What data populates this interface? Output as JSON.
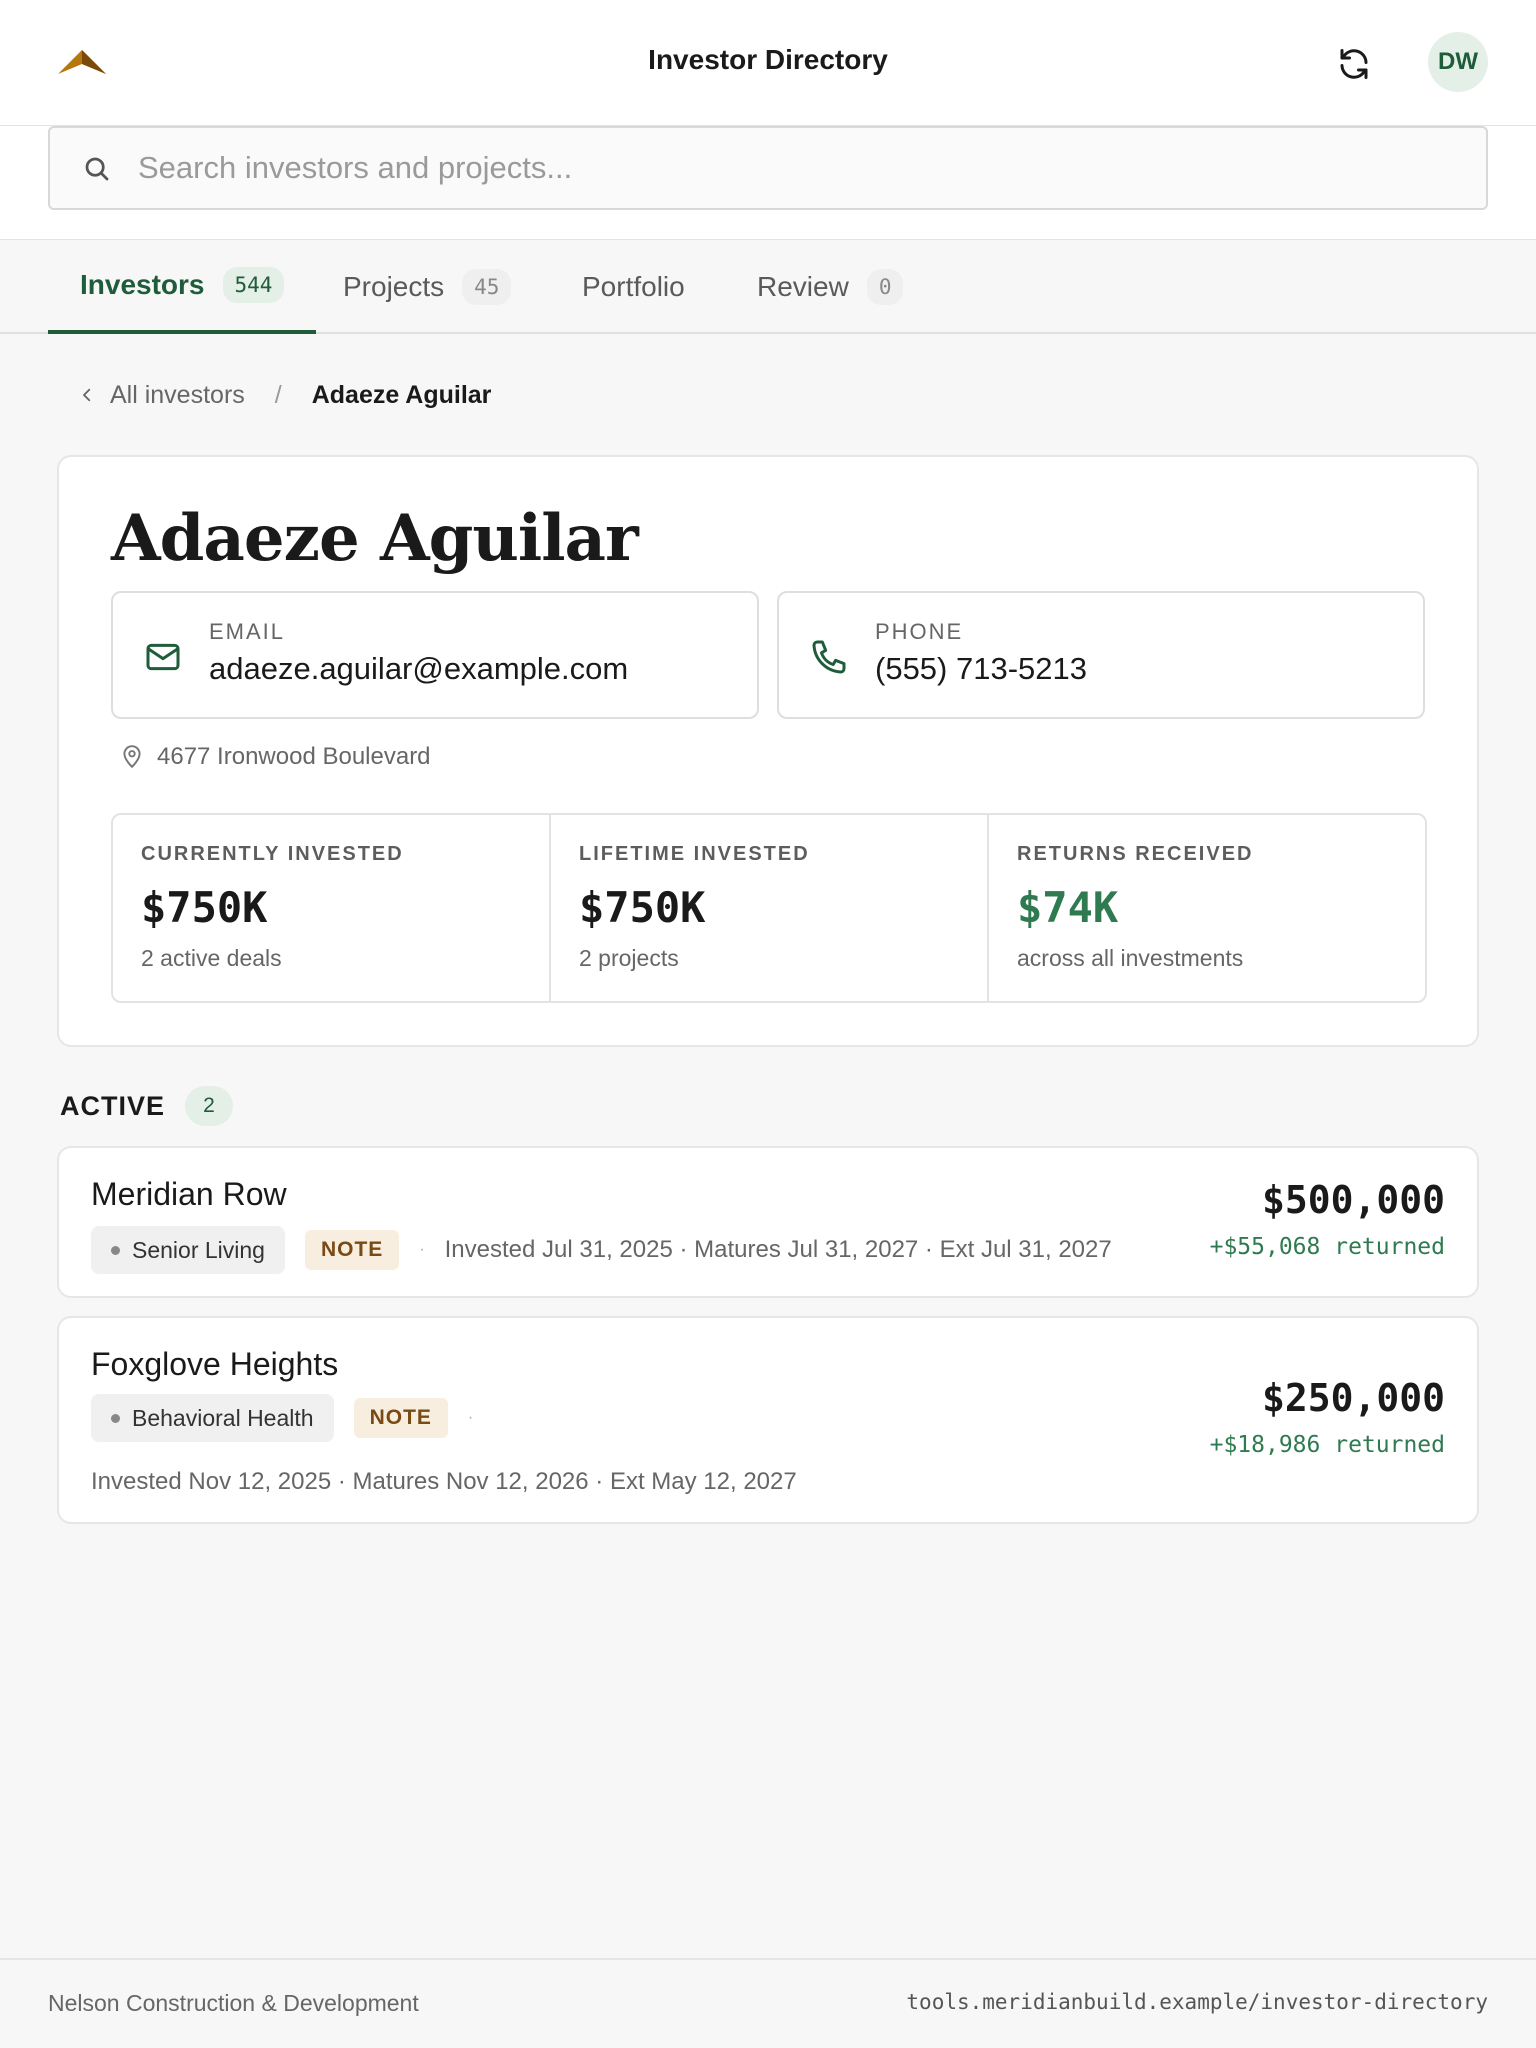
{
  "header": {
    "title": "Investor Directory",
    "avatar_initials": "DW",
    "logo_icon": "mountain-logo-icon",
    "refresh_icon": "refresh-icon"
  },
  "search": {
    "placeholder": "Search investors and projects...",
    "value": ""
  },
  "tabs": [
    {
      "label": "Investors",
      "count": "544",
      "active": true
    },
    {
      "label": "Projects",
      "count": "45",
      "active": false
    },
    {
      "label": "Portfolio",
      "count": "",
      "active": false
    },
    {
      "label": "Review",
      "count": "0",
      "active": false
    }
  ],
  "breadcrumb": {
    "back_label": "All investors",
    "separator": "/",
    "current": "Adaeze Aguilar"
  },
  "investor": {
    "name": "Adaeze Aguilar",
    "email_label": "EMAIL",
    "email": "adaeze.aguilar@example.com",
    "phone_label": "PHONE",
    "phone": "(555) 713-5213",
    "address": "4677 Ironwood Boulevard"
  },
  "stats": [
    {
      "label": "CURRENTLY INVESTED",
      "value": "$750K",
      "sub": "2 active deals"
    },
    {
      "label": "LIFETIME INVESTED",
      "value": "$750K",
      "sub": "2 projects"
    },
    {
      "label": "RETURNS RECEIVED",
      "value": "$74K",
      "sub": "across all investments"
    }
  ],
  "active_section": {
    "title": "ACTIVE",
    "count": "2"
  },
  "deals": [
    {
      "name": "Meridian Row",
      "sector": "Senior Living",
      "type": "NOTE",
      "dates": "Invested Jul 31, 2025 · Matures Jul 31, 2027 · Ext Jul 31, 2027",
      "amount": "$500,000",
      "returned": "+$55,068 returned"
    },
    {
      "name": "Foxglove Heights",
      "sector": "Behavioral Health",
      "type": "NOTE",
      "dates": "Invested Nov 12, 2025 · Matures Nov 12, 2026 · Ext May 12, 2027",
      "amount": "$250,000",
      "returned": "+$18,986 returned"
    }
  ],
  "footer": {
    "company": "Nelson Construction & Development",
    "url": "tools.meridianbuild.example/investor-directory"
  },
  "colors": {
    "accent": "#1e5c3a",
    "positive": "#2f7a50",
    "note_tag_bg": "#f8eee0",
    "note_tag_text": "#7a4a14",
    "logo": "#b5780f"
  }
}
